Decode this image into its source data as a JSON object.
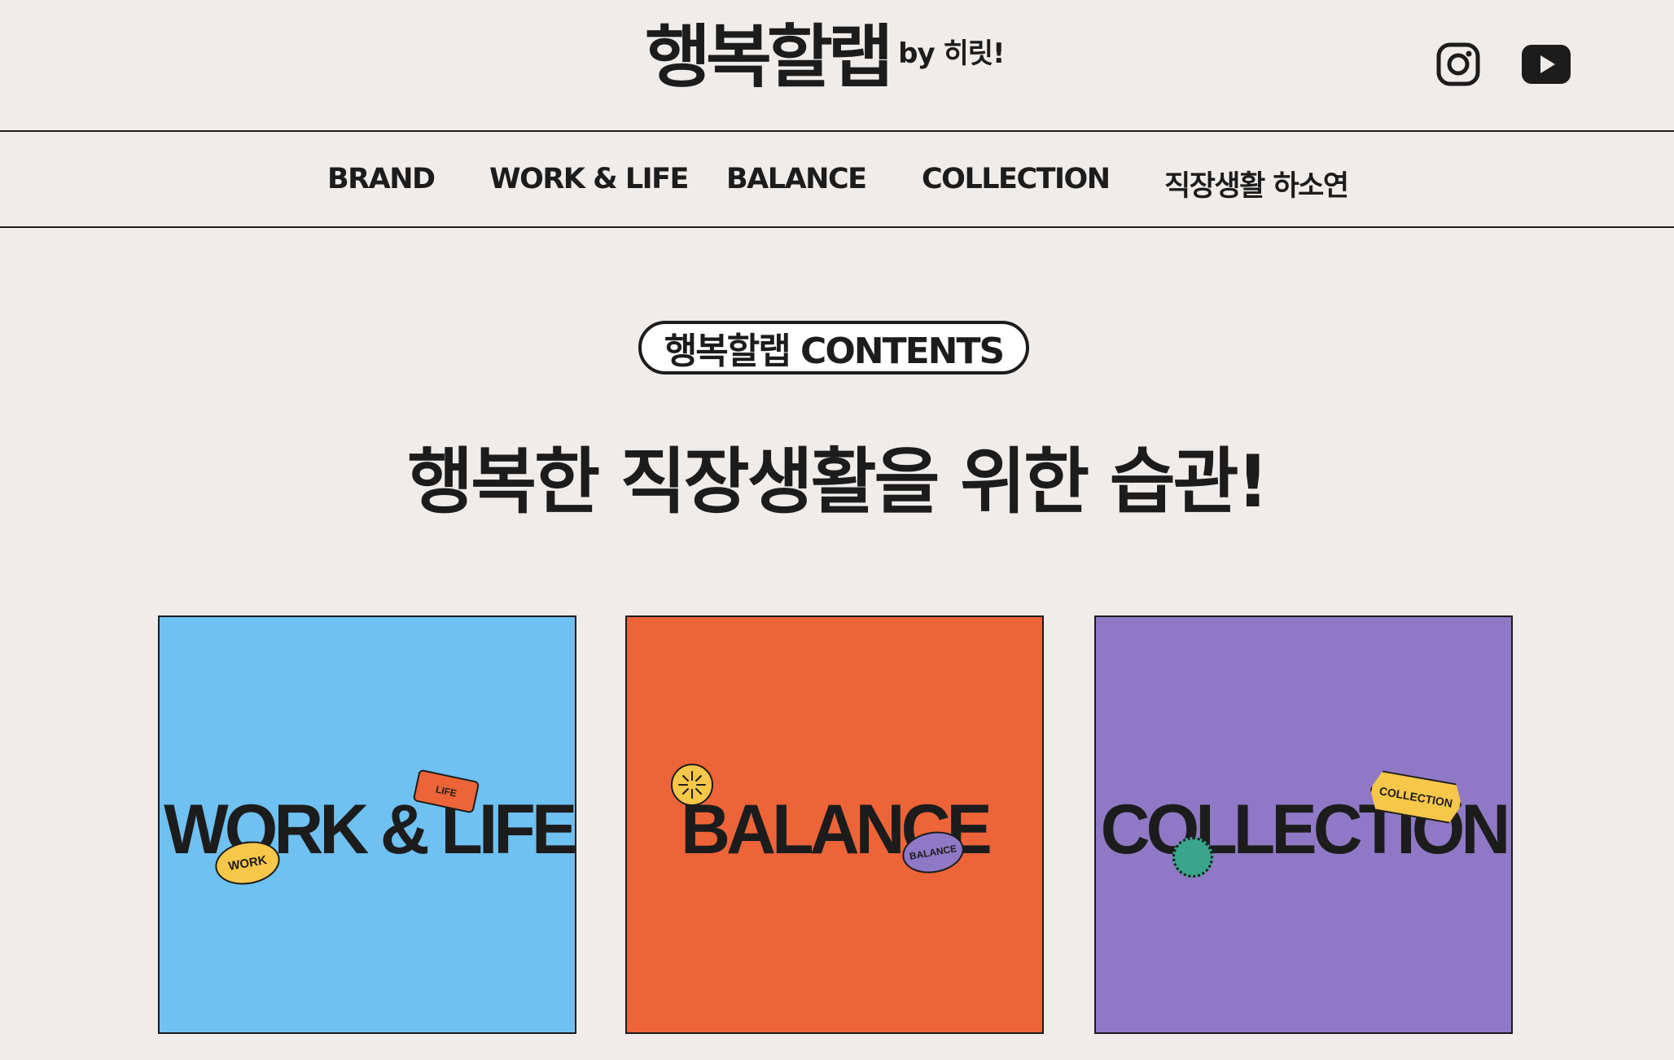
{
  "header": {
    "logo_main": "행복할랩",
    "logo_by": "by 히릿!",
    "social": [
      {
        "icon": "instagram-icon"
      },
      {
        "icon": "youtube-icon"
      }
    ]
  },
  "nav": {
    "items": [
      {
        "label": "BRAND"
      },
      {
        "label": "WORK & LIFE"
      },
      {
        "label": "BALANCE"
      },
      {
        "label": "COLLECTION"
      },
      {
        "label": "직장생활 하소연"
      }
    ]
  },
  "section": {
    "badge": "행복할랩 CONTENTS",
    "headline": "행복한 직장생활을 위한 습관!"
  },
  "cards": [
    {
      "title": "WORK & LIFE",
      "color": "#6ec1f1",
      "stickers": [
        "WORK",
        "LIFE"
      ]
    },
    {
      "title": "BALANCE",
      "color": "#ed6438",
      "stickers": [
        "BALANCE"
      ]
    },
    {
      "title": "COLLECTION",
      "color": "#8f79c6",
      "stickers": [
        "COLLECTION"
      ]
    }
  ],
  "colors": {
    "background": "#efecea",
    "ink": "#1c1c1c",
    "sticker_yellow": "#f7c74a",
    "sticker_green": "#3aa58c"
  }
}
